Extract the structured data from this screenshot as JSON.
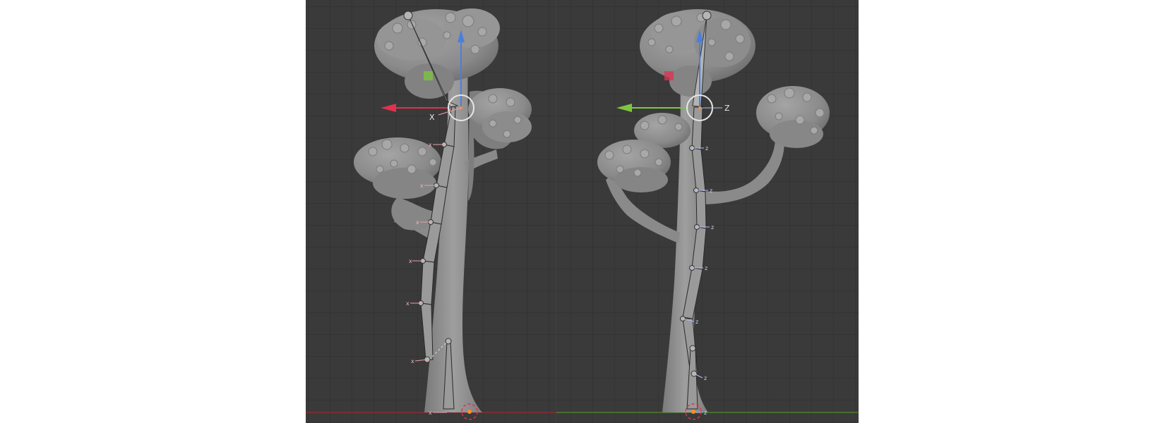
{
  "viewport_left": {
    "gizmo_axis_label": "X",
    "bone_axis_letter": "x"
  },
  "viewport_right": {
    "gizmo_axis_label": "Z",
    "bone_axis_letter": "z"
  },
  "colors": {
    "viewport_bg": "#3a3a3a",
    "grid": "#2f2f2f",
    "mesh": "#8f8f8f",
    "x_axis": "#e0314f",
    "y_axis": "#7ec63e",
    "z_axis": "#4a7fe0",
    "floor_line_left": "#9b2a36",
    "floor_line_right": "#4f8c2a"
  },
  "icons": [
    "move-gizmo-x-arrow",
    "move-gizmo-y-arrow",
    "move-gizmo-z-arrow",
    "pivot-circle-icon",
    "plane-handle-icon",
    "origin-cursor-icon"
  ]
}
